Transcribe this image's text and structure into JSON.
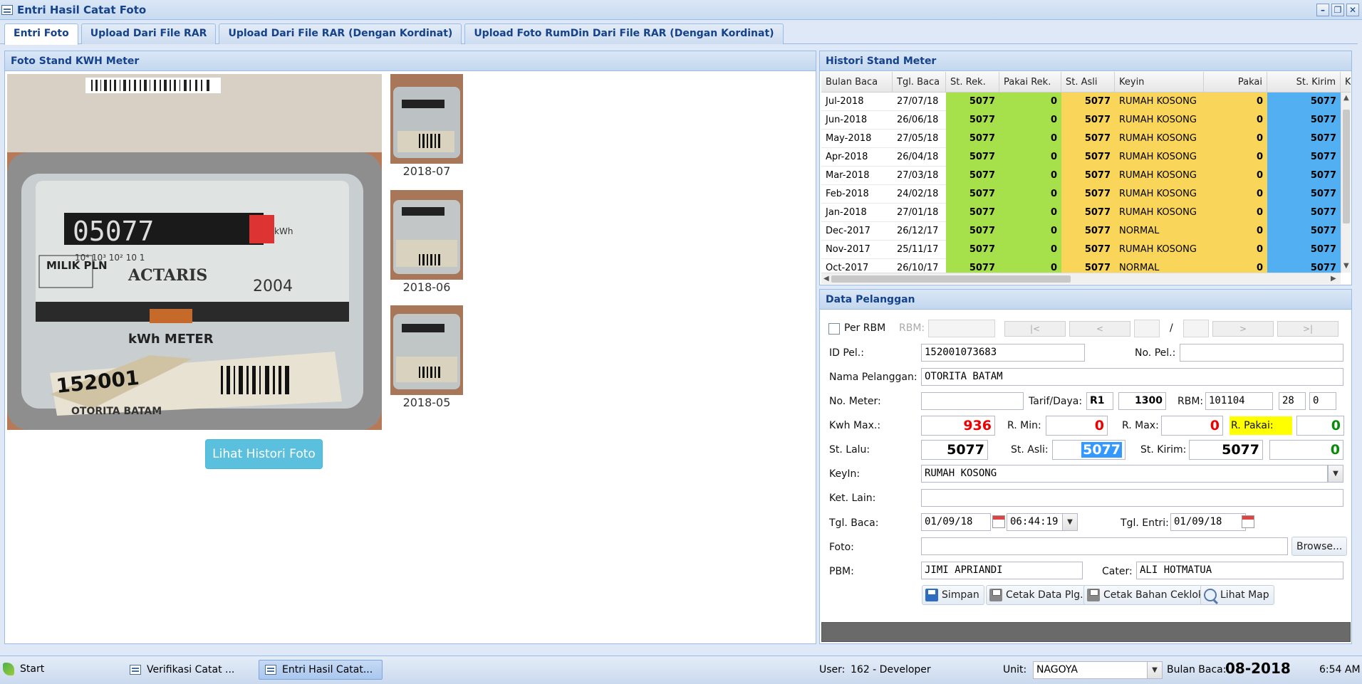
{
  "window": {
    "title": "Entri Hasil Catat Foto",
    "minimize": "–",
    "restore": "❐",
    "close": "✕"
  },
  "tabs": [
    {
      "label": "Entri Foto",
      "active": true
    },
    {
      "label": "Upload Dari File RAR"
    },
    {
      "label": "Upload Dari File RAR (Dengan Kordinat)"
    },
    {
      "label": "Upload Foto RumDin Dari File RAR (Dengan Kordinat)"
    }
  ],
  "photo_panel": {
    "title": "Foto Stand KWH Meter",
    "main_photo": {
      "reading": "05077",
      "brand": "ACTARIS",
      "owner_label": "MILIK PLN",
      "year": "2004",
      "unit": "kWh METER",
      "sticker": "152001",
      "customer": "OTORITA BATAM"
    },
    "thumbnails": [
      {
        "label": "2018-07"
      },
      {
        "label": "2018-06"
      },
      {
        "label": "2018-05"
      }
    ],
    "history_button": "Lihat Histori Foto"
  },
  "history_panel": {
    "title": "Histori Stand Meter",
    "columns": [
      "Bulan Baca",
      "Tgl. Baca",
      "St. Rek.",
      "Pakai Rek.",
      "St. Asli",
      "Keyin",
      "Pakai",
      "St. Kirim",
      "Ke"
    ],
    "rows": [
      [
        "Jul-2018",
        "27/07/18",
        "5077",
        "0",
        "5077",
        "RUMAH KOSONG",
        "0",
        "5077"
      ],
      [
        "Jun-2018",
        "26/06/18",
        "5077",
        "0",
        "5077",
        "RUMAH KOSONG",
        "0",
        "5077"
      ],
      [
        "May-2018",
        "27/05/18",
        "5077",
        "0",
        "5077",
        "RUMAH KOSONG",
        "0",
        "5077"
      ],
      [
        "Apr-2018",
        "26/04/18",
        "5077",
        "0",
        "5077",
        "RUMAH KOSONG",
        "0",
        "5077"
      ],
      [
        "Mar-2018",
        "27/03/18",
        "5077",
        "0",
        "5077",
        "RUMAH KOSONG",
        "0",
        "5077"
      ],
      [
        "Feb-2018",
        "24/02/18",
        "5077",
        "0",
        "5077",
        "RUMAH KOSONG",
        "0",
        "5077"
      ],
      [
        "Jan-2018",
        "27/01/18",
        "5077",
        "0",
        "5077",
        "RUMAH KOSONG",
        "0",
        "5077"
      ],
      [
        "Dec-2017",
        "26/12/17",
        "5077",
        "0",
        "5077",
        "NORMAL",
        "0",
        "5077"
      ],
      [
        "Nov-2017",
        "25/11/17",
        "5077",
        "0",
        "5077",
        "RUMAH KOSONG",
        "0",
        "5077"
      ],
      [
        "Oct-2017",
        "26/10/17",
        "5077",
        "0",
        "5077",
        "NORMAL",
        "0",
        "5077"
      ]
    ],
    "colors": {
      "rek": "#a6e04a",
      "asli": "#f9d65a",
      "kirim": "#52b0f2"
    }
  },
  "customer_panel": {
    "title": "Data Pelanggan",
    "per_rbm_label": "Per RBM",
    "rbm_label": "RBM:",
    "nav": {
      "first": "|<",
      "prev": "<",
      "sep": "/",
      "next": ">",
      "last": ">|"
    },
    "id_pel_label": "ID Pel.:",
    "id_pel": "152001073683",
    "no_pel_label": "No. Pel.:",
    "no_pel": "",
    "nama_label": "Nama Pelanggan:",
    "nama": "OTORITA BATAM",
    "no_meter_label": "No. Meter:",
    "no_meter": "",
    "tarif_label": "Tarif/Daya:",
    "tarif": "R1",
    "daya": "1300",
    "rbm2_label": "RBM:",
    "rbm_code": "101104",
    "rbm_a": "28",
    "rbm_b": "0",
    "kwh_max_label": "Kwh Max.:",
    "kwh_max": "936",
    "r_min_label": "R. Min:",
    "r_min": "0",
    "r_max_label": "R. Max:",
    "r_max": "0",
    "r_pakai_label": "R. Pakai:",
    "r_pakai": "0",
    "st_lalu_label": "St. Lalu:",
    "st_lalu": "5077",
    "st_asli_label": "St. Asli:",
    "st_asli": "5077",
    "st_kirim_label": "St. Kirim:",
    "st_kirim": "5077",
    "st_kirim_pakai": "0",
    "keyin_label": "KeyIn:",
    "keyin": "RUMAH KOSONG",
    "ket_lain_label": "Ket. Lain:",
    "ket_lain": "",
    "tgl_baca_label": "Tgl. Baca:",
    "tgl_baca": "01/09/18",
    "jam_baca": "06:44:19",
    "tgl_entri_label": "Tgl. Entri:",
    "tgl_entri": "01/09/18",
    "foto_label": "Foto:",
    "foto": "",
    "browse": "Browse...",
    "pbm_label": "PBM:",
    "pbm": "JIMI APRIANDI",
    "cater_label": "Cater:",
    "cater": "ALI HOTMATUA",
    "buttons": {
      "simpan": "Simpan",
      "cetak_data": "Cetak Data Plg.",
      "cetak_bahan": "Cetak Bahan Ceklok",
      "lihat_map": "Lihat Map"
    }
  },
  "taskbar": {
    "start": "Start",
    "tasks": [
      {
        "label": "Verifikasi Catat ..."
      },
      {
        "label": "Entri Hasil Catat...",
        "active": true
      }
    ],
    "user_label": "User:",
    "user": "162 - Developer",
    "unit_label": "Unit:",
    "unit": "NAGOYA",
    "bulan_label": "Bulan Baca:",
    "bulan": "08-2018",
    "time": "6:54 AM"
  }
}
